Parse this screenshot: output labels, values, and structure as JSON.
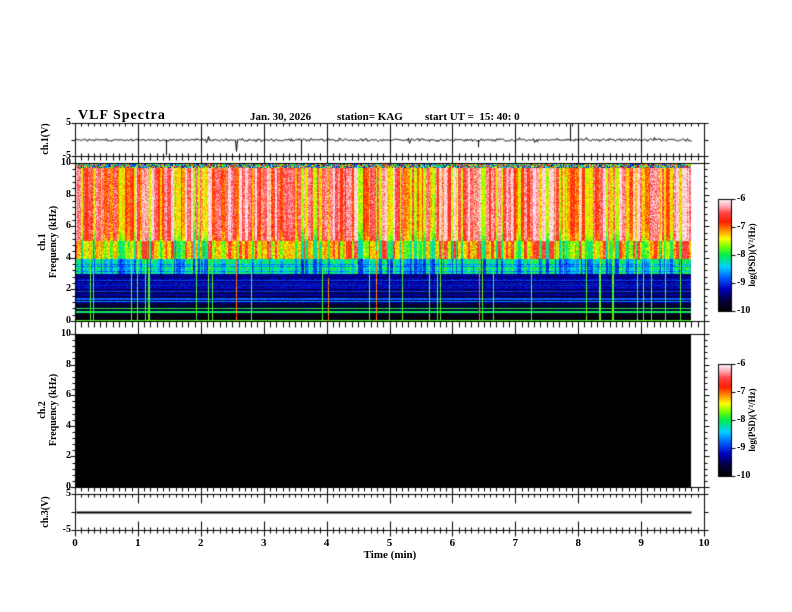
{
  "header": {
    "title": "VLF Spectra",
    "date": "Jan. 30, 2026",
    "station": "station= KAG",
    "start_ut": "start UT =  15: 40: 0"
  },
  "axes": {
    "time": {
      "label": "Time (min)",
      "min": 0,
      "max": 10,
      "tick_labels": [
        "0",
        "1",
        "2",
        "3",
        "4",
        "5",
        "6",
        "7",
        "8",
        "9",
        "10"
      ],
      "minor_step_min": 0.1,
      "data_end_min": 9.8
    },
    "frequency": {
      "tick_labels": [
        "0",
        "2",
        "4",
        "6",
        "8",
        "10"
      ],
      "min_khz": 0,
      "max_khz": 10,
      "minor_step_khz": 0.4
    },
    "voltage": {
      "tick_labels": [
        "5",
        "-5"
      ],
      "min_v": -5,
      "max_v": 5
    }
  },
  "panels": {
    "ch1_wave": {
      "ylabel": "ch.1(V)"
    },
    "ch1_spec": {
      "ylabel_line1": "ch.1",
      "ylabel_line2": "Frequency (kHz)"
    },
    "ch2_spec": {
      "ylabel_line1": "ch.2",
      "ylabel_line2": "Frequency (kHz)"
    },
    "ch3_wave": {
      "ylabel": "ch.3(V)"
    }
  },
  "colorbar": {
    "label": "log(PSD)(V²/Hz)",
    "tick_labels": [
      "-6",
      "-7",
      "-8",
      "-9",
      "-10"
    ],
    "min": -10,
    "max": -6,
    "gradient_stops": [
      {
        "t": 0.0,
        "color": [
          0,
          0,
          0
        ]
      },
      {
        "t": 0.1,
        "color": [
          5,
          0,
          60
        ]
      },
      {
        "t": 0.2,
        "color": [
          0,
          0,
          190
        ]
      },
      {
        "t": 0.3,
        "color": [
          0,
          90,
          255
        ]
      },
      {
        "t": 0.4,
        "color": [
          0,
          210,
          255
        ]
      },
      {
        "t": 0.5,
        "color": [
          0,
          235,
          80
        ]
      },
      {
        "t": 0.58,
        "color": [
          120,
          255,
          0
        ]
      },
      {
        "t": 0.65,
        "color": [
          255,
          255,
          0
        ]
      },
      {
        "t": 0.72,
        "color": [
          255,
          150,
          0
        ]
      },
      {
        "t": 0.8,
        "color": [
          255,
          30,
          0
        ]
      },
      {
        "t": 0.88,
        "color": [
          255,
          70,
          70
        ]
      },
      {
        "t": 0.94,
        "color": [
          255,
          170,
          180
        ]
      },
      {
        "t": 1.0,
        "color": [
          255,
          244,
          246
        ]
      }
    ]
  },
  "chart_data": [
    {
      "id": "ch1_waveform",
      "type": "line",
      "ylabel": "ch.1(V)",
      "y_range_V": [
        -5,
        5
      ],
      "x_range_min": [
        0,
        10
      ],
      "baseline_V": 0,
      "noise_amp_V": 0.5,
      "data_end_min": 9.8,
      "spikes": [
        {
          "t_min": 1.45,
          "V": -4.6
        },
        {
          "t_min": 3.6,
          "V": -4.9
        },
        {
          "t_min": 6.4,
          "V": -2.2
        },
        {
          "t_min": 7.87,
          "V": 4.8
        },
        {
          "t_min": 9.0,
          "V": -1.8
        }
      ]
    },
    {
      "id": "ch1_spectrogram",
      "type": "heatmap",
      "ylabel": "ch.1 Frequency (kHz)",
      "y_range_kHz": [
        0,
        10
      ],
      "x_range_min": [
        0,
        10
      ],
      "data_end_min": 9.8,
      "psd_range_log": [
        -10,
        -6
      ],
      "seed": 1337,
      "bands": [
        {
          "f_kHz": [
            9.78,
            10.0
          ],
          "pattern": "speckled mixed-color top edge"
        },
        {
          "f_kHz": [
            5.1,
            9.78
          ],
          "pattern": "dense vertical red/white streaks, yellow-green gaps"
        },
        {
          "f_kHz": [
            4.0,
            5.1
          ],
          "pattern": "yellow-green with red streak tails"
        },
        {
          "f_kHz": [
            3.0,
            4.0
          ],
          "pattern": "blue-green mottle with green vertical lines"
        },
        {
          "f_kHz": [
            2.0,
            3.0
          ],
          "pattern": "dark blue speckle, faint horizontal banding"
        },
        {
          "f_kHz": [
            1.1,
            2.0
          ],
          "pattern": "blue speckle band"
        },
        {
          "f_kHz": [
            0.45,
            1.1
          ],
          "pattern": "very dark, sparse blue dots"
        },
        {
          "f_kHz": [
            0.0,
            0.45
          ],
          "pattern": "near-black"
        }
      ],
      "horizontal_lines_kHz": [
        {
          "f": 2.62,
          "t": 0.25
        },
        {
          "f": 2.3,
          "t": 0.24
        },
        {
          "f": 1.9,
          "t": 0.27
        },
        {
          "f": 1.45,
          "t": 0.3
        },
        {
          "f": 1.28,
          "t": 0.33
        },
        {
          "f": 0.82,
          "t": 0.52
        },
        {
          "f": 0.6,
          "t": 0.5
        },
        {
          "f": 0.05,
          "t": 0.55
        }
      ],
      "vertical_green_line_density_per_min": 2.2,
      "vertical_hot_lines_t_min": [
        2.55,
        4.0,
        4.77,
        6.4
      ]
    },
    {
      "id": "ch2_spectrogram",
      "type": "heatmap",
      "ylabel": "ch.2 Frequency (kHz)",
      "y_range_kHz": [
        0,
        10
      ],
      "x_range_min": [
        0,
        10
      ],
      "data_end_min": 9.8,
      "psd_range_log": [
        -10,
        -6
      ],
      "uniform": "black — no signal, at/below -10"
    },
    {
      "id": "ch3_waveform",
      "type": "line",
      "ylabel": "ch.3(V)",
      "y_range_V": [
        -5,
        5
      ],
      "x_range_min": [
        0,
        10
      ],
      "constant_V": 0,
      "data_end_min": 9.8
    }
  ]
}
